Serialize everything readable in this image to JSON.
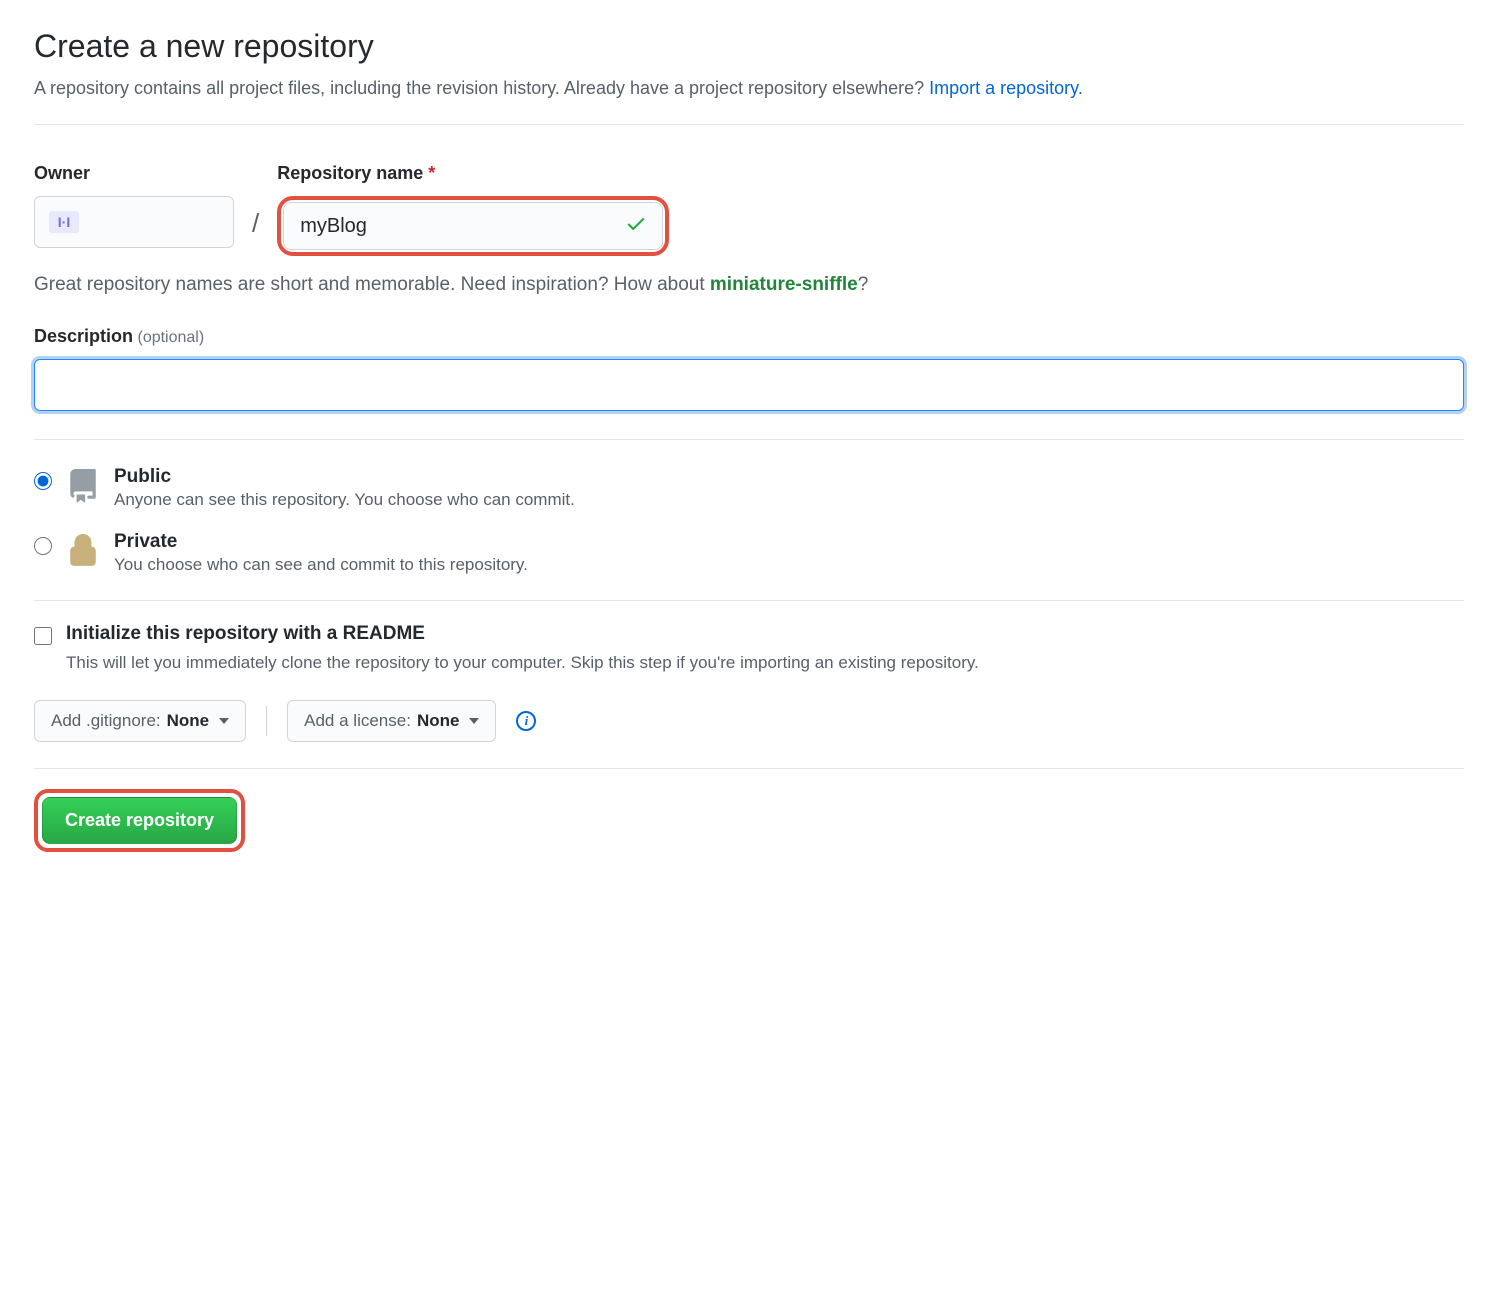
{
  "header": {
    "title": "Create a new repository",
    "subtitle_pre": "A repository contains all project files, including the revision history. Already have a project repository elsewhere? ",
    "import_link": "Import a repository."
  },
  "owner": {
    "label": "Owner"
  },
  "repo": {
    "label": "Repository name",
    "required": "*",
    "value": "myBlog",
    "hint_pre": "Great repository names are short and memorable. Need inspiration? How about ",
    "suggestion": "miniature-sniffle",
    "hint_post": "?"
  },
  "description": {
    "label": "Description",
    "optional": "(optional)",
    "value": ""
  },
  "visibility": {
    "public": {
      "title": "Public",
      "desc": "Anyone can see this repository. You choose who can commit."
    },
    "private": {
      "title": "Private",
      "desc": "You choose who can see and commit to this repository."
    }
  },
  "init": {
    "title": "Initialize this repository with a README",
    "desc": "This will let you immediately clone the repository to your computer. Skip this step if you're importing an existing repository."
  },
  "selectors": {
    "gitignore_pre": "Add .gitignore:",
    "gitignore_val": "None",
    "license_pre": "Add a license:",
    "license_val": "None"
  },
  "submit": {
    "label": "Create repository"
  }
}
